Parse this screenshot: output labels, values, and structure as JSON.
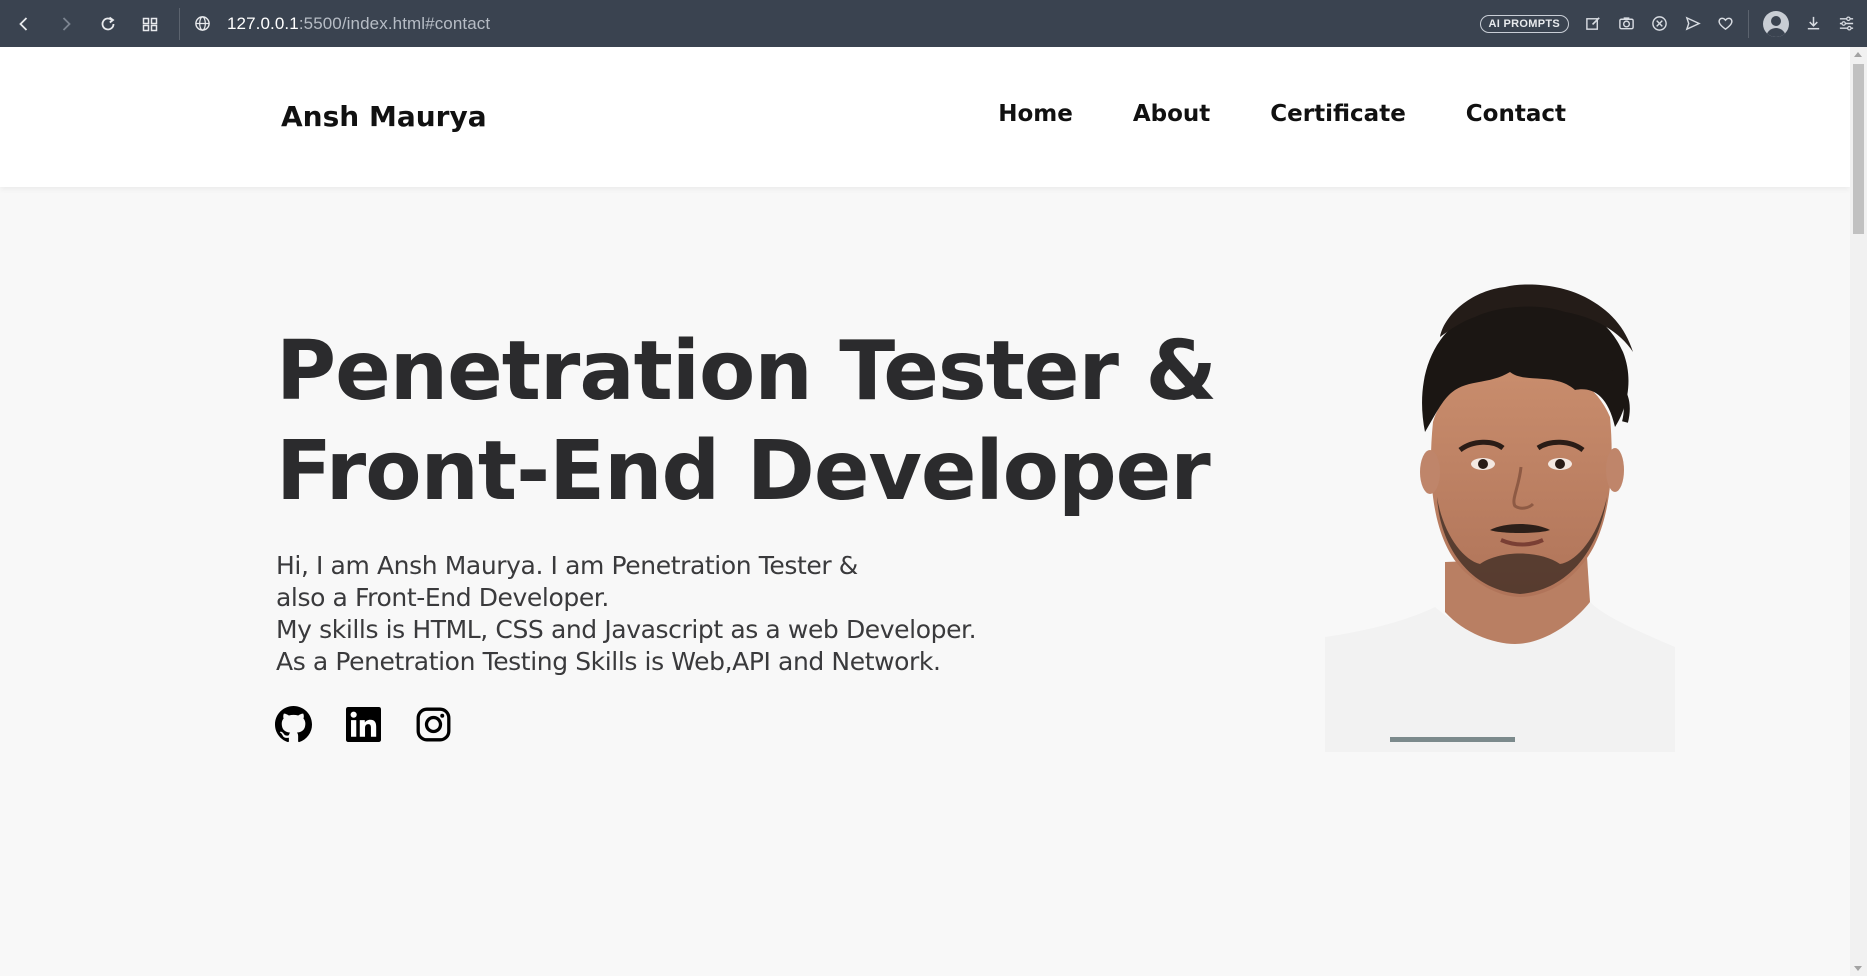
{
  "browser": {
    "url_host": "127.0.0.1",
    "url_path": ":5500/index.html#contact",
    "ai_prompts_label": "AI PROMPTS",
    "icons": [
      "back-icon",
      "forward-icon",
      "reload-icon",
      "tab-grid-icon",
      "site-info-icon",
      "edit-icon",
      "camera-icon",
      "shield-x-icon",
      "send-icon",
      "heart-icon",
      "profile-icon",
      "download-icon",
      "menu-icon"
    ]
  },
  "header": {
    "logo": "Ansh Maurya",
    "nav": [
      "Home",
      "About",
      "Certificate",
      "Contact"
    ]
  },
  "hero": {
    "title_line1": "Penetration Tester &",
    "title_line2": "Front-End Developer",
    "desc_lines": [
      "Hi, I am Ansh Maurya. I am Penetration Tester &",
      "also a Front-End Developer.",
      "My skills is HTML, CSS and Javascript as a web Developer.",
      "As a Penetration Testing Skills is Web,API and Network."
    ],
    "socials": [
      "github-icon",
      "linkedin-icon",
      "instagram-icon"
    ]
  },
  "colors": {
    "chrome_bg": "#3a4350",
    "page_bg": "#f8f8f8",
    "header_bg": "#ffffff",
    "title_text": "#2b2b2d"
  }
}
